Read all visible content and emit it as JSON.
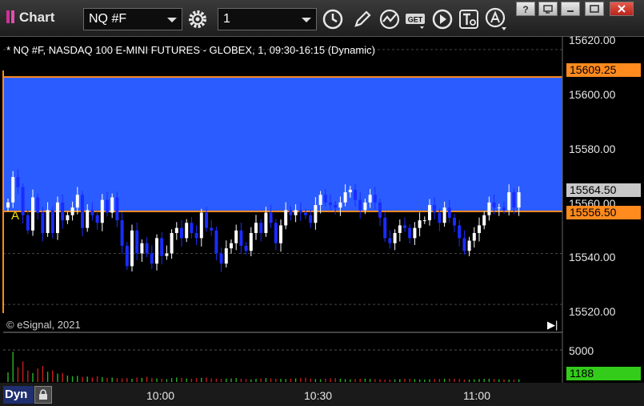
{
  "app": {
    "title": "Chart"
  },
  "toolbar": {
    "symbol": "NQ #F",
    "interval": "1"
  },
  "chart": {
    "title": "* NQ #F, NASDAQ 100 E-MINI FUTURES - GLOBEX, 1, 09:30-16:15 (Dynamic)",
    "copyright": "© eSignal, 2021",
    "marker": "A",
    "price_axis": [
      "15620.00",
      "15600.00",
      "15580.00",
      "15560.00",
      "15540.00",
      "15520.00"
    ],
    "tags": {
      "upper": "15609.25",
      "last": "15564.50",
      "lower": "15556.50"
    },
    "volume_axis": {
      "top": "5000",
      "last": "1188"
    },
    "time_axis": [
      "10:00",
      "10:30",
      "11:00"
    ],
    "dyn_label": "Dyn",
    "colors": {
      "zone": "#2b5cff",
      "zone_edge": "#ff8a1e",
      "up_candle": "#ffffff",
      "down_candle": "#1a2cff",
      "tag_orange": "#ff8a1e",
      "tag_grey": "#c8c8c8",
      "tag_green": "#33cc1a"
    }
  },
  "chart_data": {
    "type": "candlestick",
    "ylim": [
      15515,
      15625
    ],
    "zone": {
      "low": 15556.5,
      "high": 15609.25
    },
    "last": 15564.5,
    "x_start": 10,
    "x_step": 6.2,
    "close": [
      15560,
      15570,
      15566,
      15555,
      15549,
      15562,
      15556,
      15548,
      15557,
      15548,
      15560,
      15553,
      15555,
      15558,
      15563,
      15550,
      15557,
      15555,
      15552,
      15561,
      15556,
      15562,
      15553,
      15543,
      15535,
      15549,
      15540,
      15544,
      15540,
      15536,
      15546,
      15539,
      15540,
      15548,
      15550,
      15546,
      15552,
      15548,
      15546,
      15556,
      15550,
      15549,
      15540,
      15536,
      15542,
      15544,
      15549,
      15543,
      15541,
      15548,
      15552,
      15548,
      15556,
      15552,
      15544,
      15551,
      15557,
      15555,
      15557,
      15556,
      15555,
      15552,
      15559,
      15563,
      15560,
      15559,
      15558,
      15560,
      15564,
      15565,
      15561,
      15557,
      15560,
      15563,
      15560,
      15554,
      15546,
      15544,
      15548,
      15551,
      15550,
      15546,
      15550,
      15553,
      15553,
      15559,
      15556,
      15552,
      15558,
      15554,
      15551,
      15546,
      15541,
      15545,
      15548,
      15551,
      15555,
      15560,
      15558,
      15558,
      15557,
      15564,
      15558,
      15564
    ],
    "volume": [
      1500,
      4700,
      2300,
      3200,
      1800,
      1400,
      2100,
      2500,
      1600,
      1800,
      1300,
      1400,
      1000,
      900,
      950,
      800,
      850,
      700,
      900,
      750,
      650,
      700,
      600,
      550,
      600,
      500,
      700,
      650,
      800,
      600,
      550,
      500,
      450,
      600,
      700,
      650,
      550,
      500,
      600,
      650,
      700,
      550,
      500,
      480,
      520,
      550,
      600,
      500,
      450,
      400,
      500,
      550,
      600,
      550,
      500,
      480,
      450,
      500,
      550,
      600,
      650,
      500,
      450,
      420,
      500,
      550,
      600,
      500,
      450,
      400,
      450,
      500,
      520,
      480,
      450,
      420,
      400,
      380,
      420,
      450,
      480,
      500,
      450,
      400,
      380,
      420,
      450,
      480,
      500,
      520,
      480,
      450,
      400,
      380,
      420,
      450,
      480,
      500,
      450,
      420,
      400,
      380,
      350,
      420
    ]
  }
}
